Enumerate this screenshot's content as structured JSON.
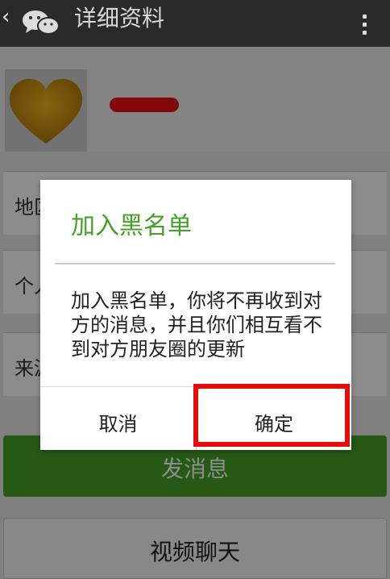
{
  "header": {
    "back_icon": "chevron-left-icon",
    "logo_icon": "wechat-logo-icon",
    "title": "详细资料",
    "more_icon": "more-vertical-icon",
    "bar_color": "#2a2a2a"
  },
  "profile": {
    "avatar_icon": "heart-icon",
    "rows": [
      {
        "label": "地区"
      },
      {
        "label": "个人"
      },
      {
        "label": "来源"
      }
    ]
  },
  "actions": {
    "send_message": "发消息",
    "video_chat": "视频聊天",
    "accent_color": "#45a129"
  },
  "dialog": {
    "title": "加入黑名单",
    "message": "加入黑名单，你将不再收到对方的消息，并且你们相互看不到对方朋友圈的更新",
    "cancel": "取消",
    "confirm": "确定",
    "highlight_color": "#e60c0c"
  }
}
